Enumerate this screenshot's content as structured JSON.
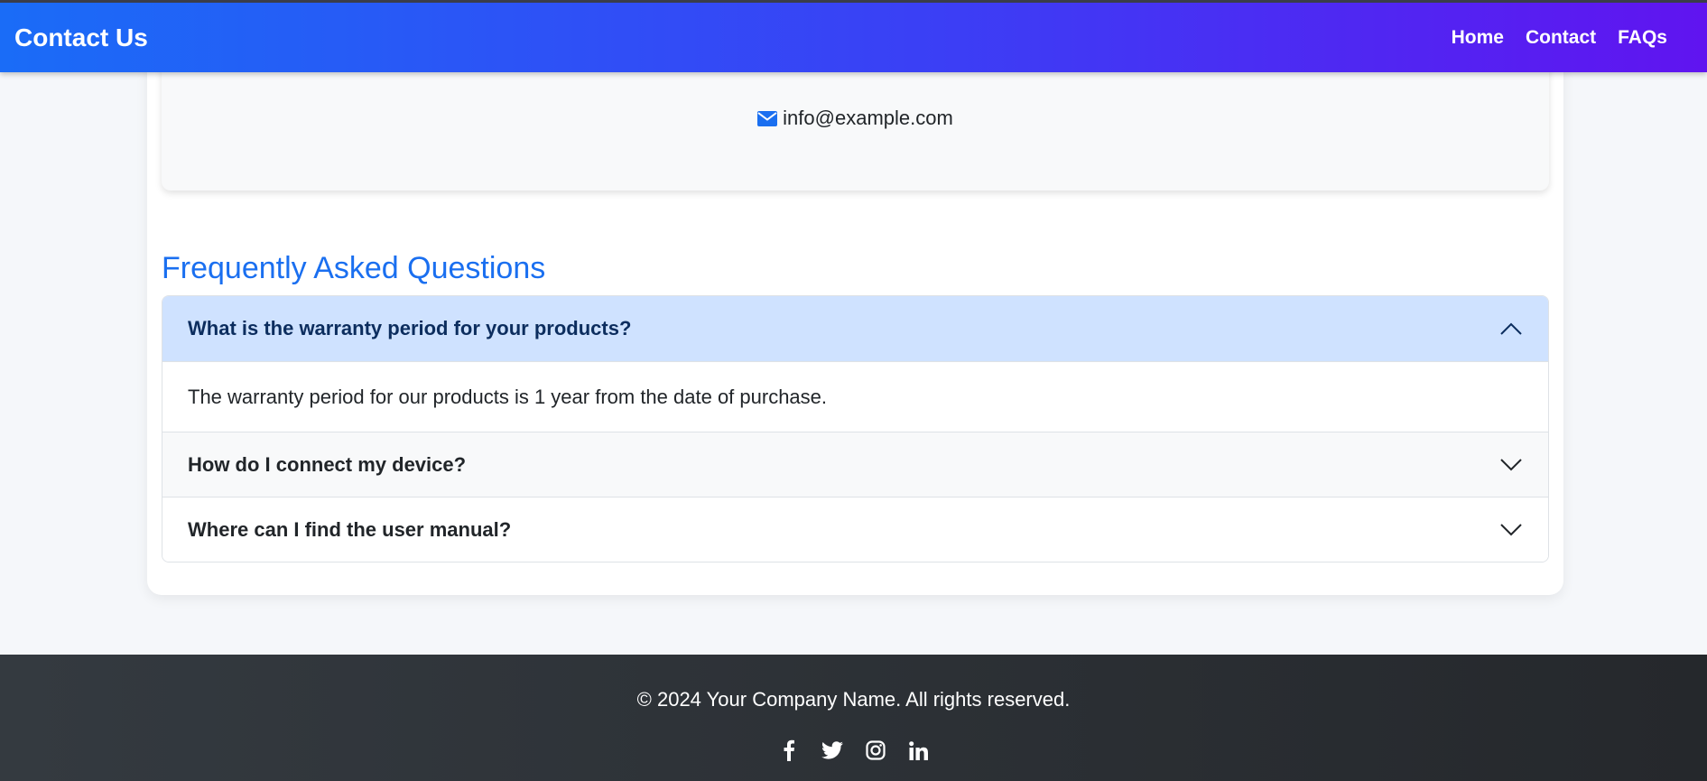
{
  "navbar": {
    "brand": "Contact Us",
    "links": [
      "Home",
      "Contact",
      "FAQs"
    ]
  },
  "contact": {
    "email": "info@example.com",
    "icon": "envelope-icon"
  },
  "faq": {
    "title": "Frequently Asked Questions",
    "items": [
      {
        "question": "What is the warranty period for your products?",
        "answer": "The warranty period for our products is 1 year from the date of purchase.",
        "expanded": true
      },
      {
        "question": "How do I connect my device?",
        "expanded": false
      },
      {
        "question": "Where can I find the user manual?",
        "expanded": false
      }
    ]
  },
  "footer": {
    "copyright": "© 2024 Your Company Name. All rights reserved.",
    "socials": [
      "facebook-icon",
      "twitter-icon",
      "instagram-icon",
      "linkedin-icon"
    ]
  },
  "colors": {
    "accent": "#1a6ff0",
    "nav_gradient_start": "#1a6cf7",
    "nav_gradient_end": "#6014f0",
    "accordion_active": "#cfe2ff",
    "footer_bg": "#343a40"
  }
}
